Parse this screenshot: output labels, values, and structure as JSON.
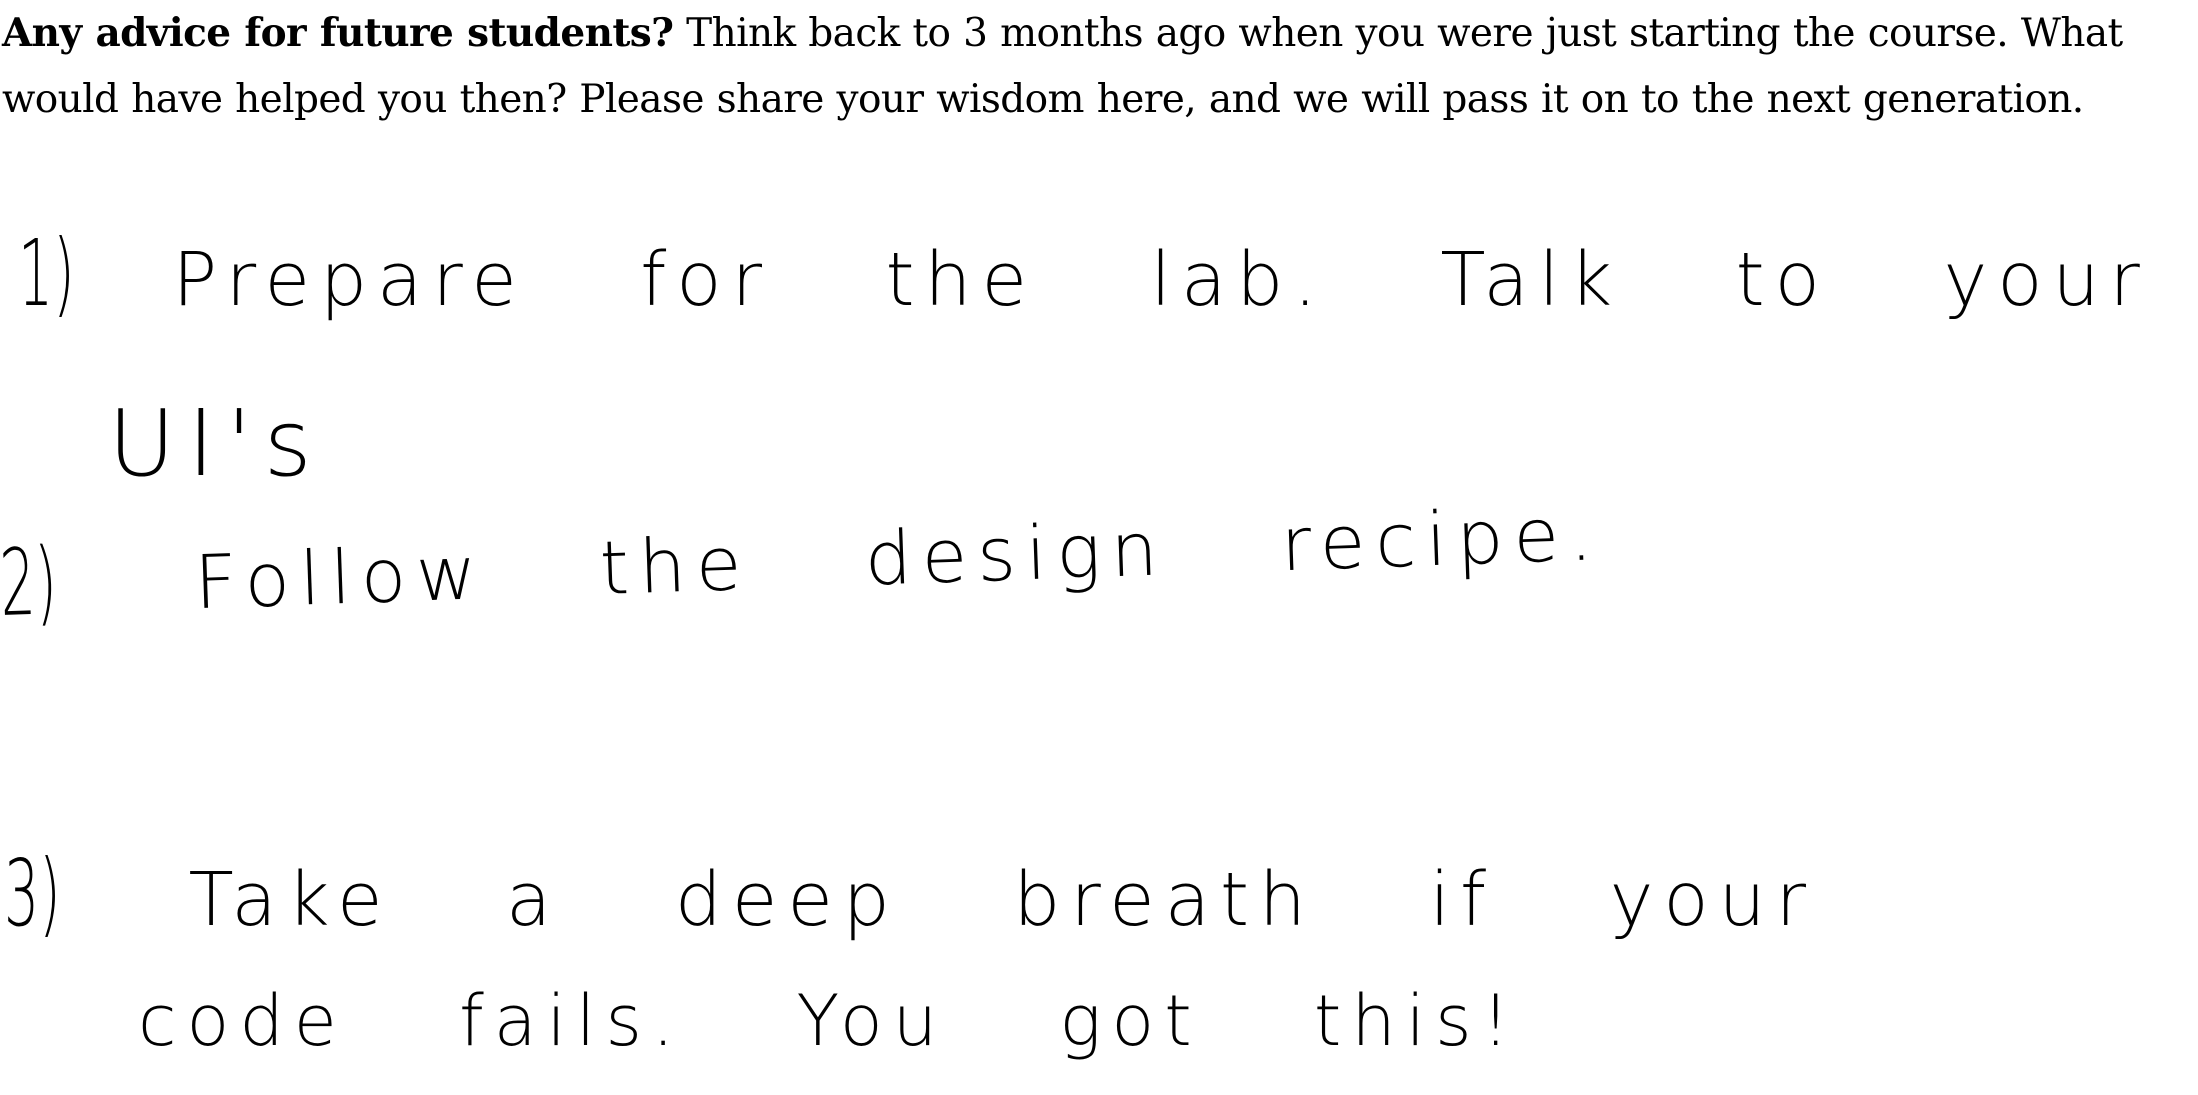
{
  "question": {
    "bold_prefix": "Any advice for future students?",
    "body": " Think back to 3 months ago when you were just starting the course. What would have helped you then? Please share your wisdom here, and we will pass it on to the next generation."
  },
  "handwritten_answer": {
    "items": [
      {
        "number": "1)",
        "text": "Prepare for the lab. Talk to your",
        "continuation": "UI's"
      },
      {
        "number": "2)",
        "text": "Follow the design recipe.",
        "continuation": ""
      },
      {
        "number": "3)",
        "text": "Take a deep breath if your",
        "continuation": "code fails. You got this!"
      }
    ]
  }
}
